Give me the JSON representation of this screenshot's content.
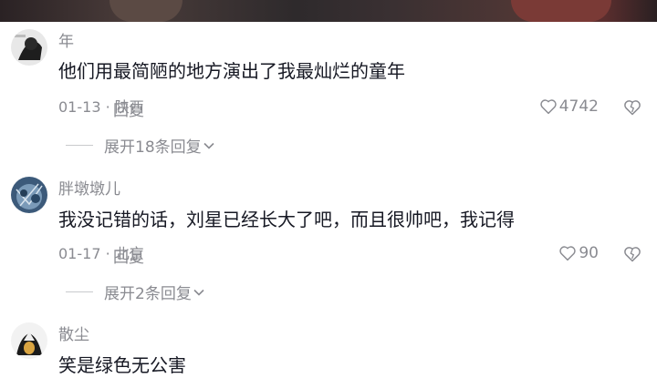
{
  "comments": [
    {
      "username": "年",
      "text": "他们用最简陋的地方演出了我最灿烂的童年",
      "date": "01-13",
      "separator": "·",
      "location": "陕西",
      "reply_label": "回复",
      "likes": "4742",
      "expand_label": "展开18条回复"
    },
    {
      "username": "胖墩墩儿",
      "text": "我没记错的话，刘星已经长大了吧，而且很帅吧，我记得",
      "date": "01-17",
      "separator": "·",
      "location": "北京",
      "reply_label": "回复",
      "likes": "90",
      "expand_label": "展开2条回复"
    },
    {
      "username": "散尘",
      "text": "笑是绿色无公害"
    }
  ],
  "icons": {
    "like": "heart-outline-icon",
    "dislike": "broken-heart-icon",
    "expand": "chevron-down-icon"
  },
  "colors": {
    "text_primary": "#161823",
    "text_secondary": "#8a8b91",
    "background": "#ffffff"
  }
}
